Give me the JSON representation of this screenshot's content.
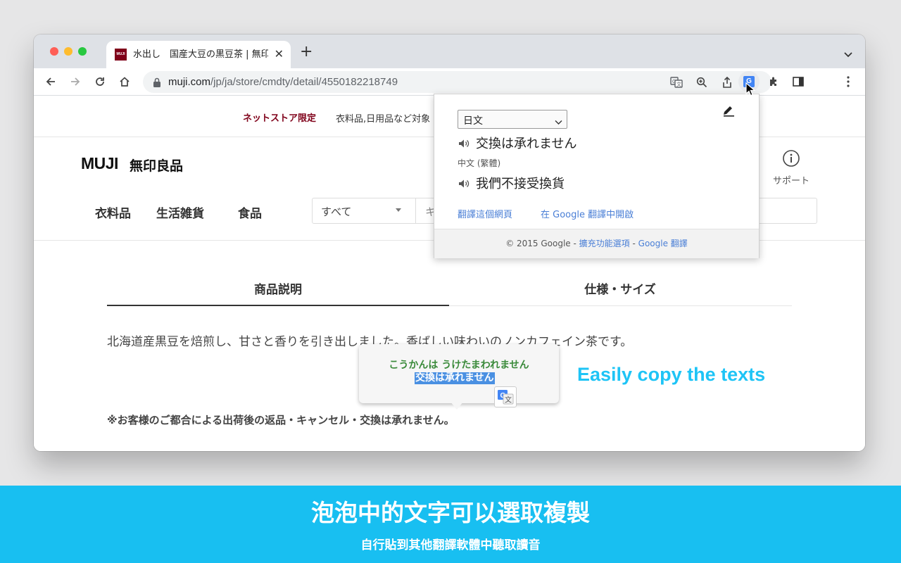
{
  "browser": {
    "tab": {
      "favicon_text": "MUJI",
      "title": "水出し　国産大豆の黒豆茶 | 無印良品"
    },
    "url_host": "muji.com",
    "url_path": "/jp/ja/store/cmdty/detail/4550182218749"
  },
  "page": {
    "promo": {
      "label": "ネットストア限定",
      "text": "衣料品,日用品など対象"
    },
    "logo": {
      "brand": "MUJI",
      "jp": "無印良品"
    },
    "support_label": "サポート",
    "categories": [
      "衣料品",
      "生活雑貨",
      "食品"
    ],
    "search": {
      "scope": "すべて",
      "placeholder": "キ"
    },
    "product_tabs": [
      "商品説明",
      "仕様・サイズ"
    ],
    "description": "北海道産黒豆を焙煎し、甘さと香りを引き出しました。香ばしい味わいのノンカフェイン茶です。",
    "notice": "※お客様のご都合による出荷後の返品・キャンセル・交換は承れません。"
  },
  "translate_popup": {
    "source_language": "日文",
    "source_text": "交換は承れません",
    "target_language": "中文 (繁體)",
    "target_text": "我們不接受換貨",
    "link_translate_page": "翻譯這個網頁",
    "link_open_google": "在 Google 翻譯中開啟",
    "footer_copyright": "© 2015 Google - ",
    "footer_options": "擴充功能選項",
    "footer_sep": " - ",
    "footer_google": "Google 翻譯"
  },
  "bubble": {
    "reading": "こうかんは うけたまわれません",
    "text": "交換は承れません"
  },
  "caption": "Easily copy the texts",
  "banner": {
    "title": "泡泡中的文字可以選取複製",
    "subtitle": "自行貼到其他翻譯軟體中聽取讀音"
  },
  "colors": {
    "banner_bg": "#18bff1",
    "caption": "#1ec4f6",
    "muji_red": "#7f0019",
    "link_blue": "#4a7fd6",
    "reading_green": "#3a8a3a",
    "selection_blue": "#4a90e2"
  },
  "icons": {
    "back": "arrow-left-icon",
    "forward": "arrow-right-icon",
    "reload": "reload-icon",
    "home": "home-icon",
    "lock": "lock-icon",
    "translate": "translate-icon",
    "zoom": "zoom-icon",
    "share": "share-icon",
    "bookmark": "star-icon",
    "extension": "puzzle-icon",
    "sidepanel": "side-panel-icon",
    "menu": "kebab-icon",
    "speaker": "speaker-icon",
    "edit": "pencil-icon",
    "info": "info-icon"
  }
}
